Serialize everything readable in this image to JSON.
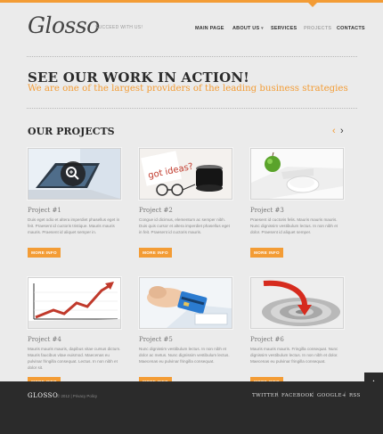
{
  "header": {
    "logo": "Glosso",
    "tagline": "SUCCEED WITH US!",
    "nav": [
      "MAIN PAGE",
      "ABOUT US",
      "SERVICES",
      "PROJECTS",
      "CONTACTS"
    ],
    "about_caret": "▾",
    "active_nav": "PROJECTS"
  },
  "hero": {
    "title": "SEE OUR WORK IN ACTION!",
    "subtitle": "We are one of the largest providers of the leading business strategies"
  },
  "projects": {
    "title": "OUR PROJECTS",
    "prev_arrow": "‹",
    "next_arrow": "›",
    "button_label": "MORE INFO",
    "items": [
      {
        "title": "Project #1",
        "text": "Duis eget odio et altera imperdiet phasellus eget in feit. Praesent id cuctoris tristique. Mauris mauris mauris. Praesent id aliquet semper in.",
        "image": "laptop-magnifier"
      },
      {
        "title": "Project #2",
        "text": "Congue id dicimus, elementum ac semper nibh. Duis quis cursor et altera imperdiet phasellus eget in feit. Praesent id cuctoris mauris.",
        "image": "got-ideas-coffee"
      },
      {
        "title": "Project #3",
        "text": "Praesent id cuctoris felis. Mauris mauris mauris. Nunc dignissim vestibulum lectus. In non nibh et dolor. Praesent id aliquet semper.",
        "image": "apple-mouse"
      },
      {
        "title": "Project #4",
        "text": "Mauris mauris mauris, dapibus vitae cursus dictum. Mauris faucibus vitae euismod. Maecenas eu pulvinar fringilla consequat. Lectus. In non nibh et dolor sit.",
        "image": "growth-chart"
      },
      {
        "title": "Project #5",
        "text": "Nunc dignissim vestibulum lectus. In non nibh et dolor ac metus. Nunc dignissim vestibulum lectus. Maecenas eu pulvinar fringilla consequat.",
        "image": "credit-card"
      },
      {
        "title": "Project #6",
        "text": "Mauris mauris mauris. Fringilla consequat. Nunc dignissim vestibulum lectus. In non nibh et dolor. Maecenas eu pulvinar fringilla consequat.",
        "image": "target-arrow"
      }
    ]
  },
  "footer": {
    "logo": "GLOSSO",
    "copyright": "© 2012 | Privacy Policy",
    "social": [
      "TWITTER",
      "FACEBOOK",
      "GOOGLE+",
      "RSS"
    ],
    "separator": "|"
  },
  "scroll_top_icon": "▲",
  "colors": {
    "accent": "#f39c35",
    "text": "#2a2a2a",
    "footer": "#2b2b2b",
    "background": "#ebebeb"
  }
}
